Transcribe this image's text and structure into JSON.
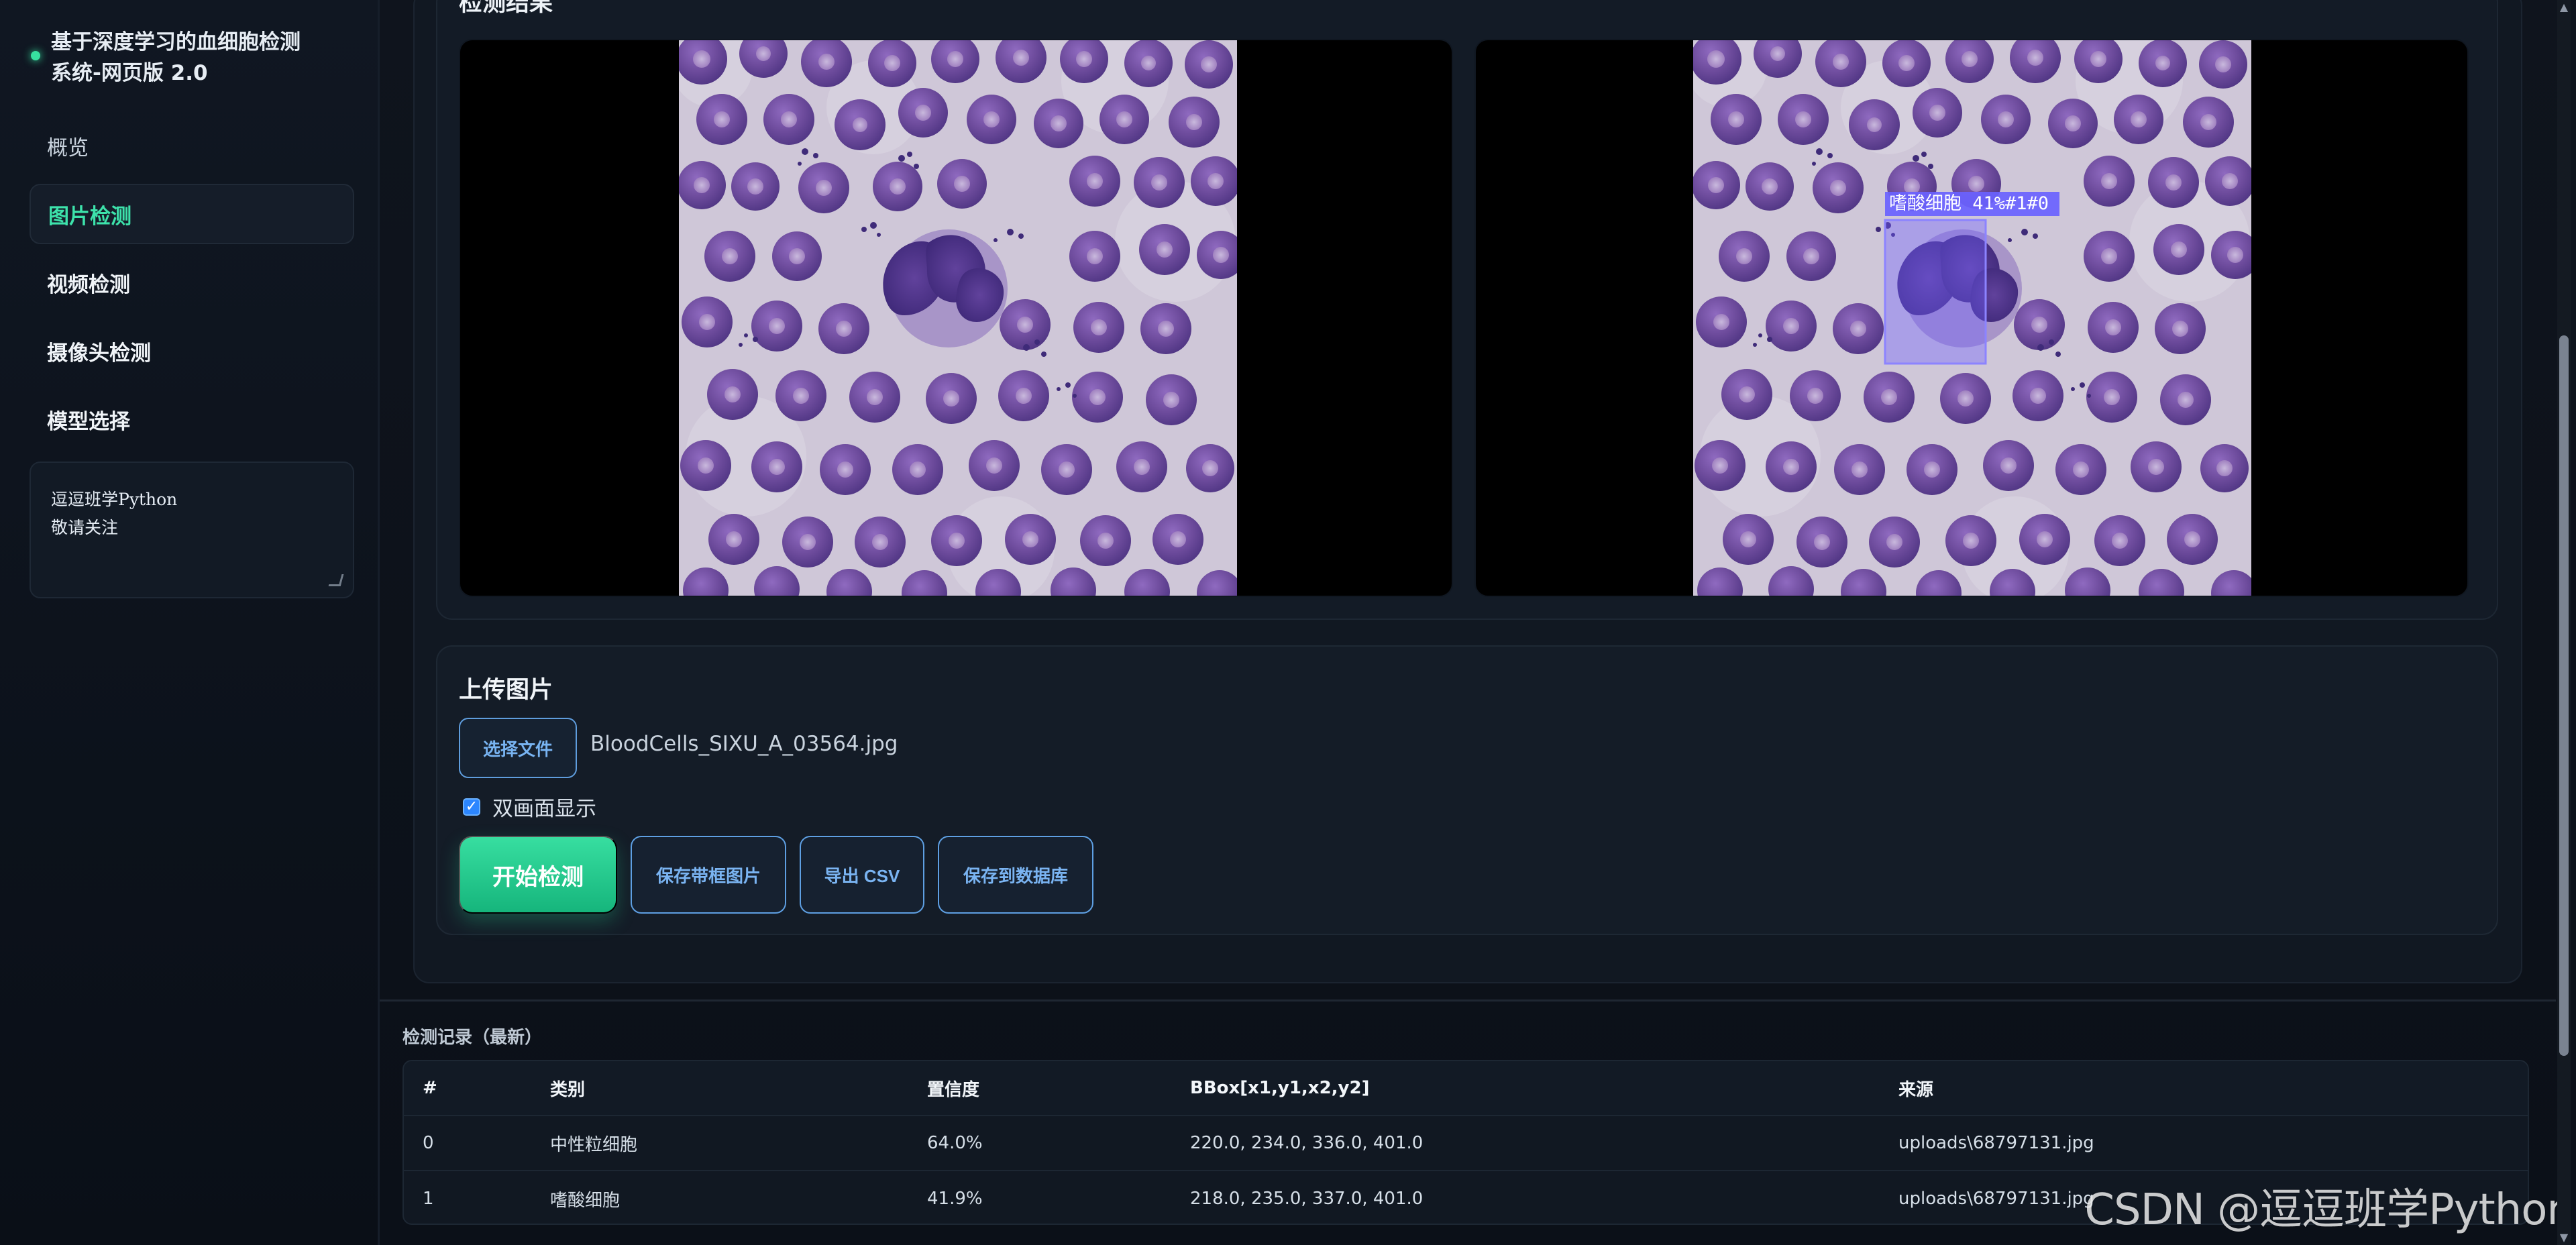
{
  "sidebar": {
    "brand_title": "基于深度学习的血细胞检测\n系统-网页版 2.0",
    "items": [
      {
        "label": "概览"
      },
      {
        "label": "图片检测"
      },
      {
        "label": "视频检测"
      },
      {
        "label": "摄像头检测"
      },
      {
        "label": "模型选择"
      }
    ],
    "note_lines": [
      "逗逗班学Python",
      "敬请关注"
    ]
  },
  "main": {
    "result_title": "检测结果",
    "overlay_label": "嗜酸细胞 41%#1#0",
    "upload_title": "上传图片",
    "file_button": "选择文件",
    "file_name": "BloodCells_SIXU_A_03564.jpg",
    "dual_view_label": "双画面显示",
    "actions": {
      "start": "开始检测",
      "save_boxed_image": "保存带框图片",
      "export_csv": "导出 CSV",
      "save_db": "保存到数据库"
    },
    "records_title": "检测记录（最新）",
    "table": {
      "headers": [
        "#",
        "类别",
        "置信度",
        "BBox[x1,y1,x2,y2]",
        "来源"
      ],
      "rows": [
        [
          "0",
          "中性粒细胞",
          "64.0%",
          "220.0, 234.0, 336.0, 401.0",
          "uploads\\68797131.jpg"
        ],
        [
          "1",
          "嗜酸细胞",
          "41.9%",
          "218.0, 235.0, 337.0, 401.0",
          "uploads\\68797131.jpg"
        ]
      ]
    }
  },
  "watermark": "CSDN @逗逗班学Python",
  "colors": {
    "accent": "#37e0a0",
    "link": "#78b4f2",
    "panel": "#131b26",
    "background": "#0f141d"
  },
  "icons": {
    "brand": "status-dot-icon",
    "checkbox": "checkbox-icon",
    "resize": "resize-handle-icon"
  }
}
